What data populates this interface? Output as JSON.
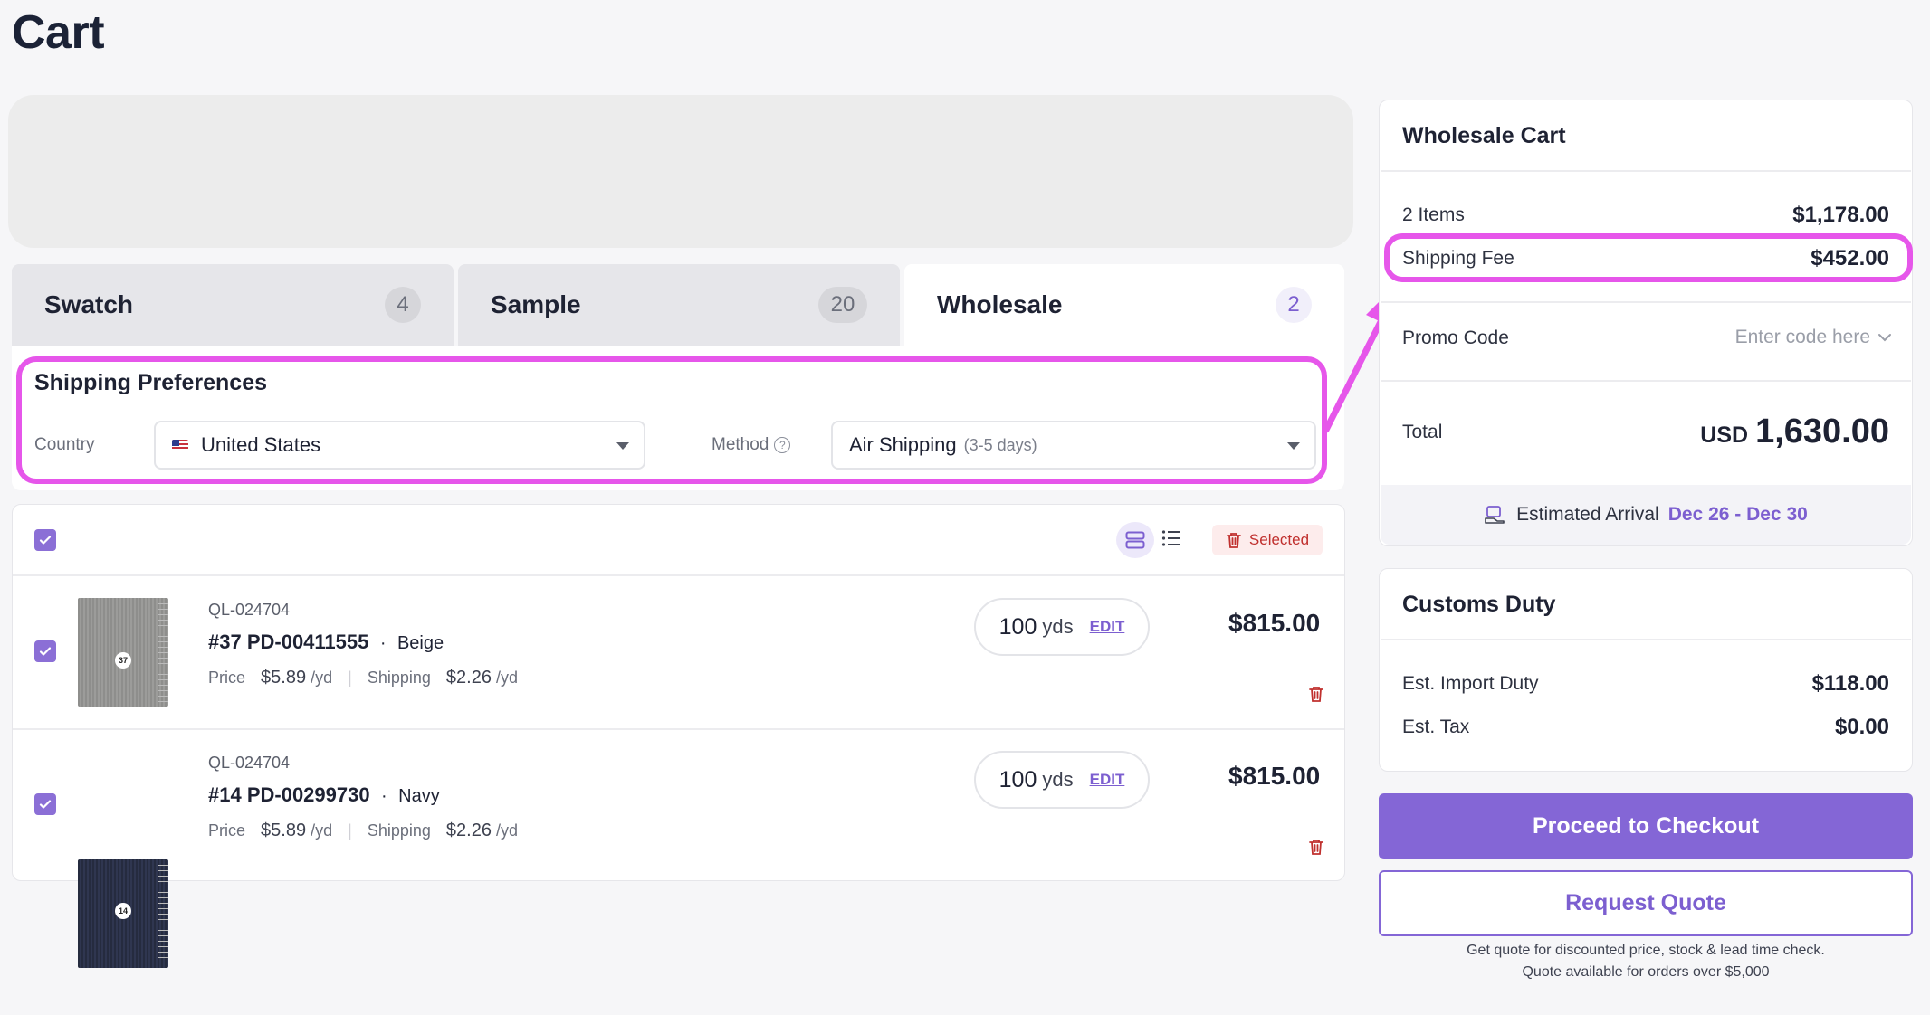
{
  "page": {
    "title": "Cart"
  },
  "tabs": [
    {
      "label": "Swatch",
      "count": "4"
    },
    {
      "label": "Sample",
      "count": "20"
    },
    {
      "label": "Wholesale",
      "count": "2"
    }
  ],
  "shipping_prefs": {
    "title": "Shipping Preferences",
    "country_label": "Country",
    "country_value": "United States",
    "method_label": "Method",
    "method_value": "Air Shipping",
    "method_sub": "(3-5 days)"
  },
  "toolbar": {
    "selected_label": "Selected"
  },
  "items": [
    {
      "sku": "QL-024704",
      "title": "#37 PD-00411555",
      "color": "Beige",
      "thumb_number": "37",
      "price_label": "Price",
      "price": "$5.89",
      "price_unit": "/yd",
      "shipping_label": "Shipping",
      "shipping": "$2.26",
      "shipping_unit": "/yd",
      "qty": "100",
      "qty_unit": "yds",
      "edit_label": "EDIT",
      "total": "$815.00"
    },
    {
      "sku": "QL-024704",
      "title": "#14 PD-00299730",
      "color": "Navy",
      "thumb_number": "14",
      "price_label": "Price",
      "price": "$5.89",
      "price_unit": "/yd",
      "shipping_label": "Shipping",
      "shipping": "$2.26",
      "shipping_unit": "/yd",
      "qty": "100",
      "qty_unit": "yds",
      "edit_label": "EDIT",
      "total": "$815.00"
    }
  ],
  "summary": {
    "title": "Wholesale Cart",
    "items_label": "2 Items",
    "items_value": "$1,178.00",
    "shipping_label": "Shipping Fee",
    "shipping_value": "$452.00",
    "promo_label": "Promo Code",
    "promo_placeholder": "Enter code here",
    "total_label": "Total",
    "total_currency": "USD",
    "total_value": "1,630.00",
    "arrival_label": "Estimated Arrival",
    "arrival_date": "Dec 26 - Dec 30"
  },
  "customs": {
    "title": "Customs Duty",
    "import_label": "Est. Import Duty",
    "import_value": "$118.00",
    "tax_label": "Est. Tax",
    "tax_value": "$0.00"
  },
  "actions": {
    "checkout_label": "Proceed to Checkout",
    "quote_label": "Request Quote",
    "quote_note_1": "Get quote for discounted price, stock & lead time check.",
    "quote_note_2": "Quote available for orders over $5,000"
  },
  "colors": {
    "accent": "#8466d6",
    "highlight": "#e656ea",
    "danger": "#c0302e"
  }
}
